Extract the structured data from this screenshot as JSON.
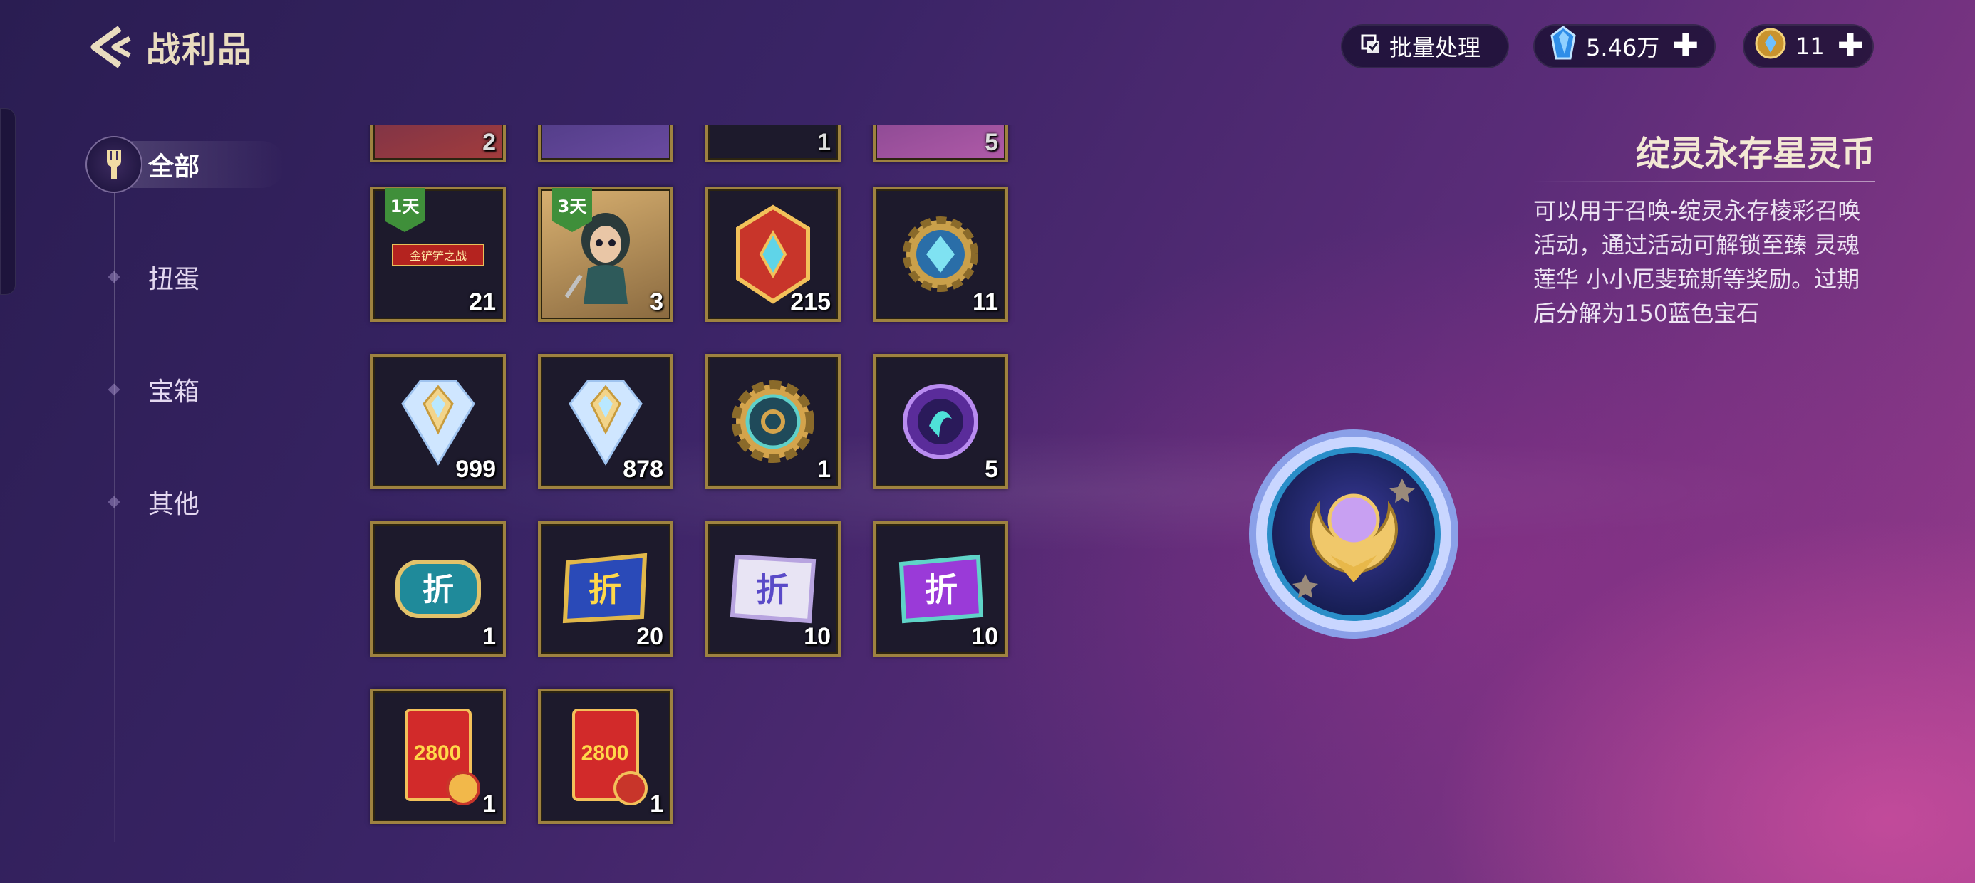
{
  "header": {
    "title": "战利品",
    "batch_label": "批量处理",
    "gems_value": "5.46万",
    "coins_value": "11",
    "plus": "✚"
  },
  "sidebar": {
    "items": [
      {
        "label": "全部",
        "active": true
      },
      {
        "label": "扭蛋",
        "active": false
      },
      {
        "label": "宝箱",
        "active": false
      },
      {
        "label": "其他",
        "active": false
      }
    ]
  },
  "grid": {
    "partial_row": [
      "2",
      "",
      "1",
      "5"
    ],
    "items": [
      {
        "name": "golden-spatula-battle-pass",
        "count": "21",
        "badge": "1天",
        "banner": "金铲铲之战"
      },
      {
        "name": "champion-skin-card",
        "count": "3",
        "badge": "3天"
      },
      {
        "name": "red-hex-token",
        "count": "215"
      },
      {
        "name": "blue-gear-token",
        "count": "11"
      },
      {
        "name": "diamond-shard",
        "count": "999"
      },
      {
        "name": "diamond-shard-2",
        "count": "878"
      },
      {
        "name": "gear-medal",
        "count": "1"
      },
      {
        "name": "spirit-orb",
        "count": "5"
      },
      {
        "name": "discount-coupon-teal",
        "count": "1"
      },
      {
        "name": "discount-coupon-blue",
        "count": "20"
      },
      {
        "name": "discount-coupon-silver",
        "count": "10"
      },
      {
        "name": "discount-coupon-purple",
        "count": "10"
      },
      {
        "name": "red-envelope-2800",
        "count": "1",
        "value_text": "2800"
      },
      {
        "name": "red-envelope-2800-2",
        "count": "1",
        "value_text": "2800"
      }
    ],
    "discount_glyph": "折"
  },
  "detail": {
    "title": "绽灵永存星灵币",
    "description": "可以用于召唤-绽灵永存棱彩召唤活动，通过活动可解锁至臻 灵魂莲华 小小厄斐琉斯等奖励。过期后分解为150蓝色宝石"
  },
  "colors": {
    "tile_border": "#9e8240",
    "title_gold": "#e9dcbf",
    "badge_green": "#3f8f3a"
  }
}
